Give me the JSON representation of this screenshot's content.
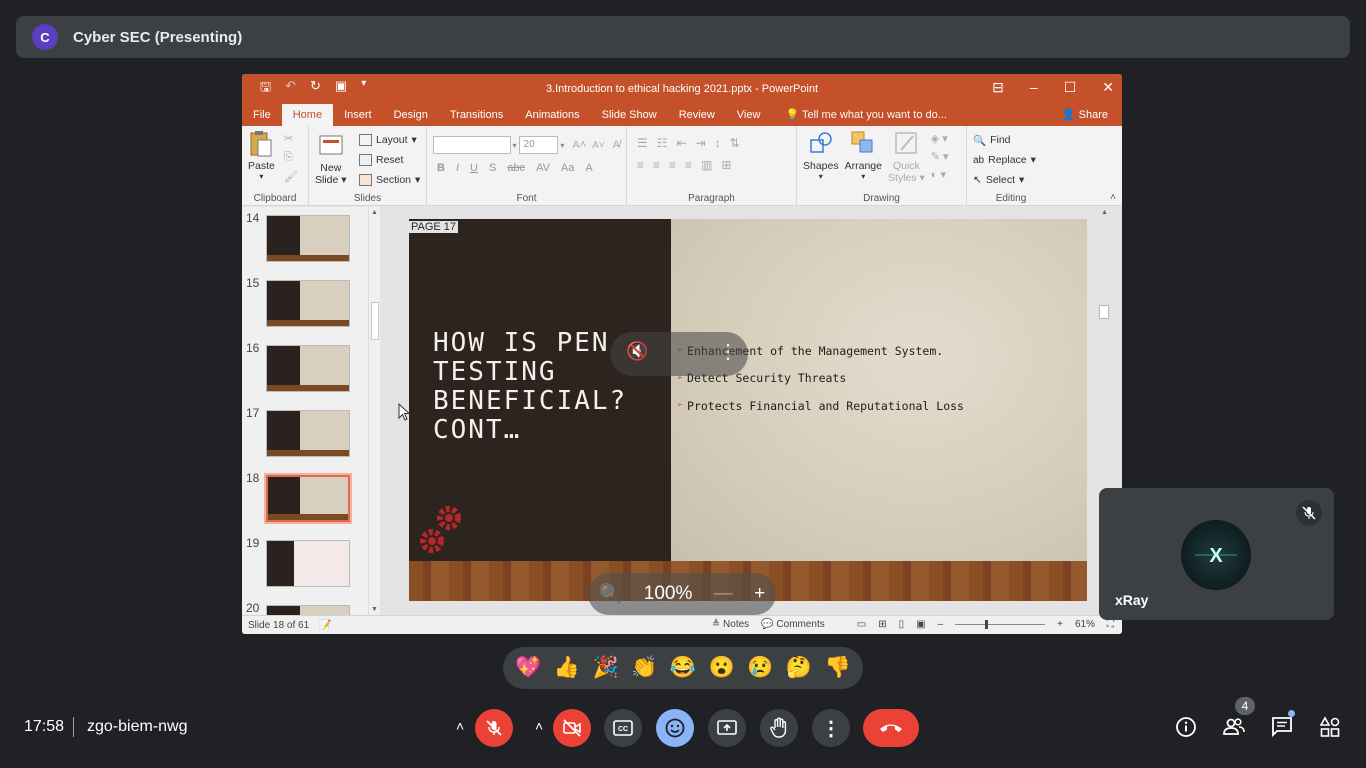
{
  "meeting": {
    "presenter_initial": "C",
    "presenting_title": "Cyber SEC (Presenting)",
    "time": "17:58",
    "code": "zgo-biem-nwg",
    "participant_count": "4"
  },
  "ppt": {
    "window_title": "3.Introduction to ethical hacking 2021.pptx - PowerPoint",
    "tabs": [
      "File",
      "Home",
      "Insert",
      "Design",
      "Transitions",
      "Animations",
      "Slide Show",
      "Review",
      "View"
    ],
    "active_tab": "Home",
    "tell_me": "Tell me what you want to do...",
    "share": "Share",
    "ribbon": {
      "paste": "Paste",
      "new_slide_1": "New",
      "new_slide_2": "Slide",
      "layout": "Layout",
      "reset": "Reset",
      "section": "Section",
      "font_size": "20",
      "shapes": "Shapes",
      "arrange": "Arrange",
      "quick_styles_1": "Quick",
      "quick_styles_2": "Styles",
      "find": "Find",
      "replace": "Replace",
      "select": "Select",
      "groups": {
        "clipboard": "Clipboard",
        "slides": "Slides",
        "font": "Font",
        "paragraph": "Paragraph",
        "drawing": "Drawing",
        "editing": "Editing"
      }
    },
    "thumbnails": [
      "14",
      "15",
      "16",
      "17",
      "18",
      "19",
      "20"
    ],
    "selected_thumbnail": "18",
    "slide": {
      "page_label": "PAGE 17",
      "title": "HOW IS PEN\nTESTING\nBENEFICIAL?\nCONT…",
      "bullets": [
        "Enhancement of the Management System.",
        "Detect Security Threats",
        "Protects Financial and Reputational Loss"
      ]
    },
    "status": {
      "slide_pos": "Slide 18 of 61",
      "notes": "Notes",
      "comments": "Comments",
      "zoom": "61%"
    }
  },
  "zoom_overlay": {
    "value": "100%"
  },
  "participant": {
    "name": "xRay"
  },
  "reactions": [
    "💖",
    "👍",
    "🎉",
    "👏",
    "😂",
    "😮",
    "😢",
    "🤔",
    "👎"
  ],
  "colors": {
    "ppt_accent": "#c5512a",
    "meet_bg": "#202124",
    "end_call_red": "#ea4335",
    "active_blue": "#8ab4f8"
  }
}
